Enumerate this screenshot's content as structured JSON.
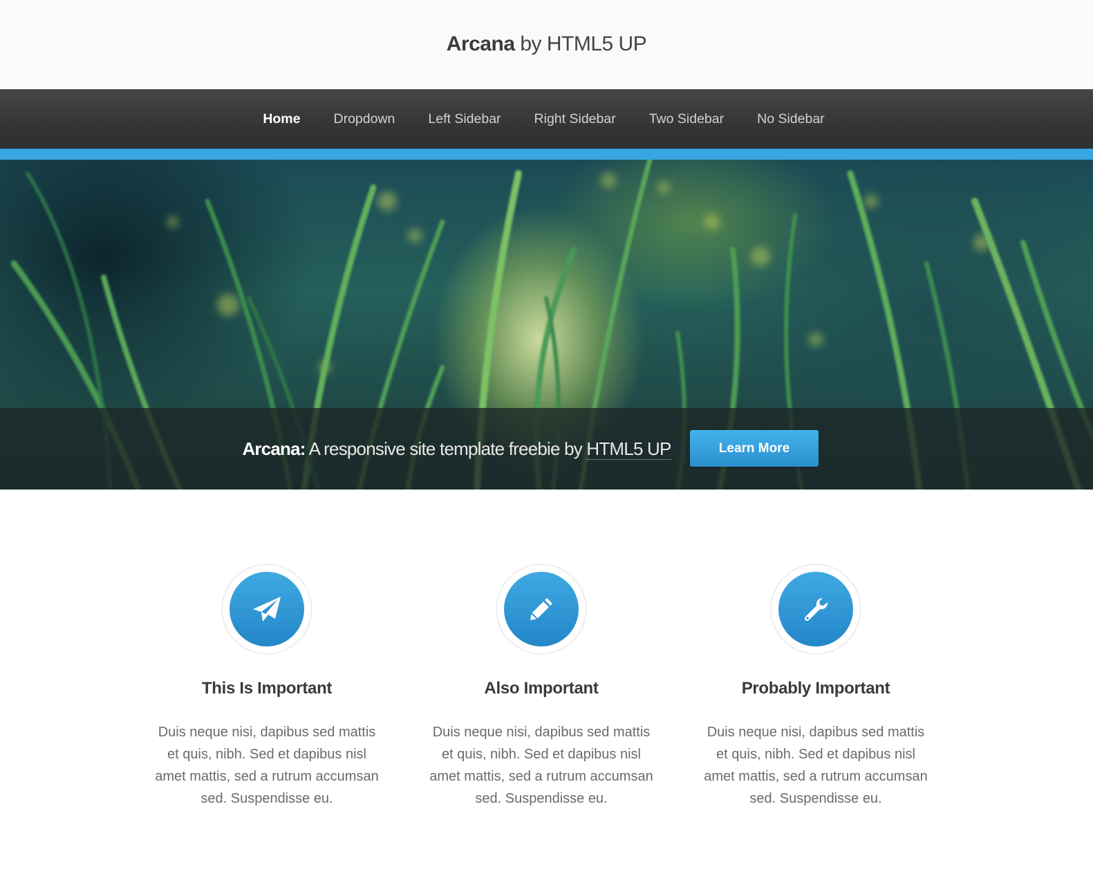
{
  "header": {
    "logo_strong": "Arcana",
    "logo_rest": " by HTML5 UP"
  },
  "nav": {
    "items": [
      {
        "label": "Home",
        "active": true
      },
      {
        "label": "Dropdown"
      },
      {
        "label": "Left Sidebar"
      },
      {
        "label": "Right Sidebar"
      },
      {
        "label": "Two Sidebar"
      },
      {
        "label": "No Sidebar"
      }
    ]
  },
  "banner": {
    "title_strong": "Arcana:",
    "title_rest": " A responsive site template freebie by ",
    "title_link": "HTML5 UP",
    "button_label": "Learn More"
  },
  "features": [
    {
      "icon": "paper-plane-icon",
      "title": "This Is Important",
      "body": "Duis neque nisi, dapibus sed mattis et quis, nibh. Sed et dapibus nisl amet mattis, sed a rutrum accumsan sed. Suspendisse eu."
    },
    {
      "icon": "pencil-icon",
      "title": "Also Important",
      "body": "Duis neque nisi, dapibus sed mattis et quis, nibh. Sed et dapibus nisl amet mattis, sed a rutrum accumsan sed. Suspendisse eu."
    },
    {
      "icon": "wrench-icon",
      "title": "Probably Important",
      "body": "Duis neque nisi, dapibus sed mattis et quis, nibh. Sed et dapibus nisl amet mattis, sed a rutrum accumsan sed. Suspendisse eu."
    }
  ],
  "colors": {
    "accent": "#37a6e2",
    "nav_bg": "#353535",
    "button": "#2a8fcf"
  }
}
